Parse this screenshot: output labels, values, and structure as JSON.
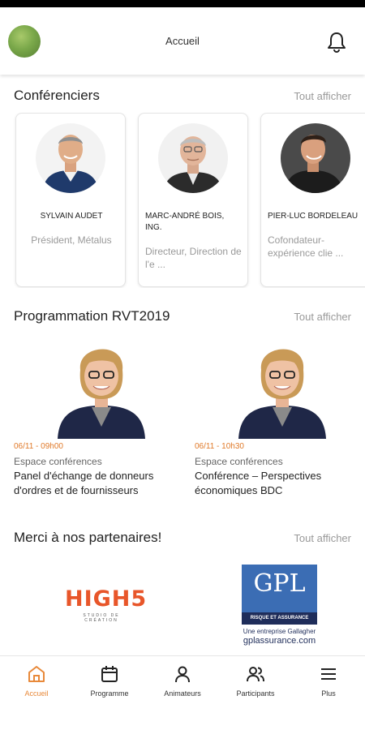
{
  "header": {
    "title": "Accueil",
    "avatar_icon": "profile-avatar",
    "notification_icon": "bell-icon"
  },
  "speakers_section": {
    "title": "Conférenciers",
    "see_all": "Tout afficher",
    "items": [
      {
        "name": "SYLVAIN AUDET",
        "role": "Président, Métalus"
      },
      {
        "name": "MARC-ANDRÉ BOIS, ING.",
        "role": "Directeur, Direction de l'e ..."
      },
      {
        "name": "PIER-LUC BORDELEAU",
        "role": "Cofondateur-expérience clie ..."
      }
    ]
  },
  "program_section": {
    "title": "Programmation RVT2019",
    "see_all": "Tout afficher",
    "items": [
      {
        "time": "06/11 - 09h00",
        "room": "Espace conférences",
        "title": "Panel d'échange de donneurs d'ordres et de fournisseurs"
      },
      {
        "time": "06/11 - 10h30",
        "room": "Espace conférences",
        "title": "Conférence – Perspectives économiques BDC"
      }
    ]
  },
  "partners_section": {
    "title": "Merci à nos partenaires!",
    "see_all": "Tout afficher",
    "partners": [
      {
        "logo_text": "HIGH5",
        "subtitle": "STUDIO DE CRÉATION"
      },
      {
        "logo_text": "GPL",
        "band": "RISQUE ET ASSURANCE",
        "tagline": "Une entreprise Gallagher",
        "url": "gplassurance.com"
      }
    ]
  },
  "bottom_nav": {
    "active_color": "#e8893a",
    "items": [
      {
        "label": "Accueil",
        "icon": "home-icon",
        "active": true
      },
      {
        "label": "Programme",
        "icon": "calendar-icon",
        "active": false
      },
      {
        "label": "Animateurs",
        "icon": "person-icon",
        "active": false
      },
      {
        "label": "Participants",
        "icon": "people-icon",
        "active": false
      },
      {
        "label": "Plus",
        "icon": "menu-icon",
        "active": false
      }
    ]
  }
}
